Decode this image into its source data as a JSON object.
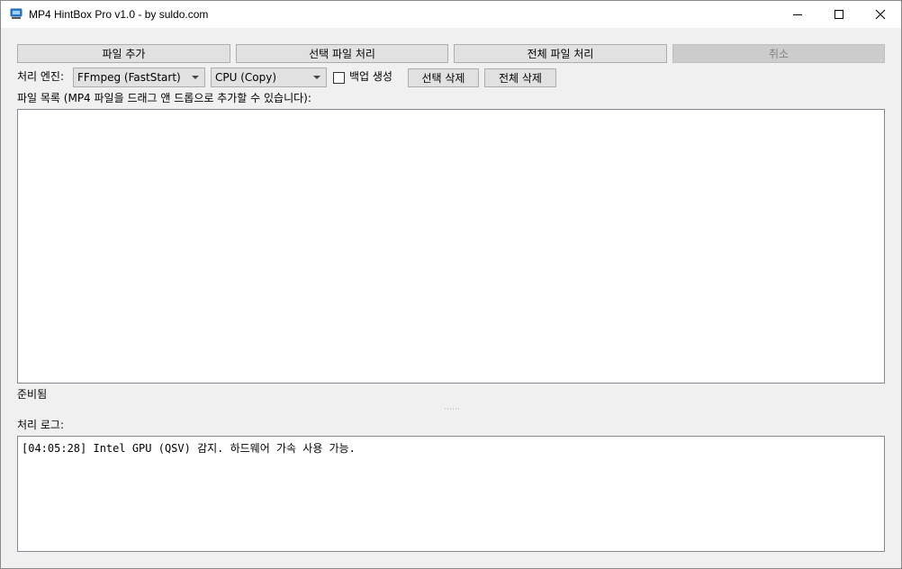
{
  "window": {
    "title": "MP4 HintBox Pro v1.0 - by suldo.com"
  },
  "toolbar": {
    "add_files": "파일 추가",
    "process_selected": "선택 파일 처리",
    "process_all": "전체 파일 처리",
    "cancel": "취소"
  },
  "options": {
    "engine_label": "처리 엔진:",
    "engine_value": "FFmpeg (FastStart)",
    "device_value": "CPU (Copy)",
    "backup_label": "백업 생성",
    "backup_checked": false,
    "delete_selected": "선택 삭제",
    "delete_all": "전체 삭제"
  },
  "file_list": {
    "label": "파일 목록 (MP4 파일을 드래그 앤 드롭으로 추가할 수 있습니다):",
    "items": []
  },
  "status": {
    "text": "준비됨"
  },
  "log": {
    "label": "처리 로그:",
    "lines": [
      "[04:05:28] Intel GPU (QSV) 감지. 하드웨어 가속 사용 가능."
    ]
  },
  "colors": {
    "accent": "#1e90ff",
    "button_bg": "#e1e1e1",
    "window_bg": "#f0f0f0"
  }
}
